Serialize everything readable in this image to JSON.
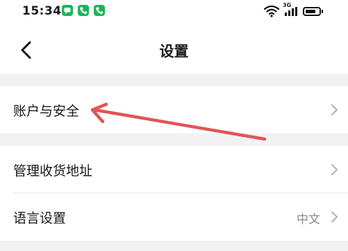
{
  "status_bar": {
    "time": "15:34",
    "network_type": "3G",
    "notifications": [
      "message-icon",
      "phone-icon",
      "phone-icon"
    ],
    "battery_level": 0.8
  },
  "header": {
    "title": "设置"
  },
  "settings": {
    "items": [
      {
        "label": "账户与安全",
        "value": ""
      },
      {
        "label": "管理收货地址",
        "value": ""
      },
      {
        "label": "语言设置",
        "value": "中文"
      }
    ]
  },
  "colors": {
    "background": "#ffffff",
    "section_gap": "#f2f2f2",
    "notification_green": "#1cb55a",
    "annotation_arrow": "#e05555",
    "secondary_text": "#8a8a8a"
  }
}
